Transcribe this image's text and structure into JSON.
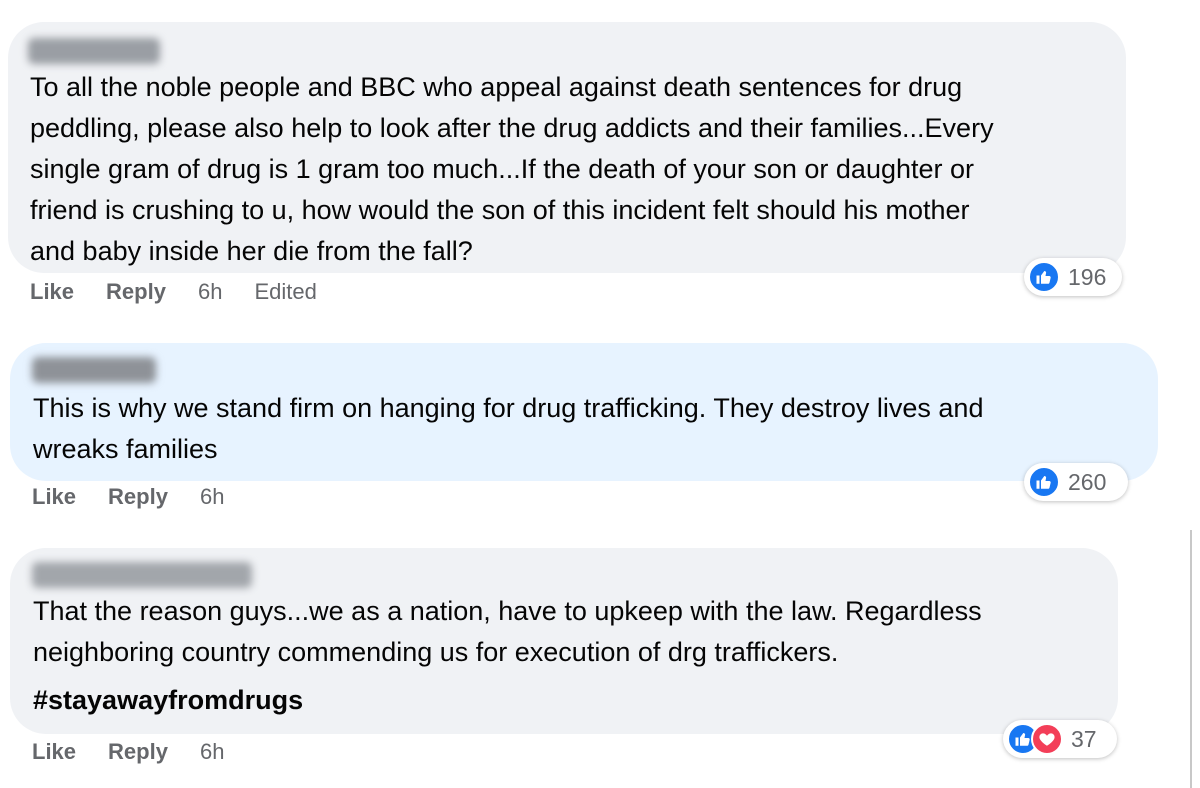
{
  "comments": [
    {
      "text": "To all the noble people and BBC who appeal against death sentences for drug\npeddling, please also help to look after the drug addicts and their families...Every\nsingle gram of drug is 1 gram too much...If the death of your son or daughter or\nfriend is crushing to u, how would the son of this incident felt should his mother\nand baby inside her die from the fall?",
      "like_label": "Like",
      "reply_label": "Reply",
      "time": "6h",
      "edited": "Edited",
      "reaction_count": "196"
    },
    {
      "text": "This is why we stand firm on hanging for drug trafficking. They destroy lives and\nwreaks families",
      "like_label": "Like",
      "reply_label": "Reply",
      "time": "6h",
      "reaction_count": "260"
    },
    {
      "text": "That the reason guys...we as a nation, have to upkeep with the law. Regardless\nneighboring country commending us for execution of drg traffickers.",
      "hashtag": "#stayawayfromdrugs",
      "like_label": "Like",
      "reply_label": "Reply",
      "time": "6h",
      "reaction_count": "37"
    }
  ],
  "colors": {
    "bubble_default": "#f0f2f5",
    "bubble_highlight": "#e7f3ff",
    "like_blue": "#1877f2",
    "love_red": "#f33e58",
    "secondary_text": "#65676b"
  },
  "icons": {
    "like": "thumbs-up-icon",
    "love": "heart-icon"
  }
}
